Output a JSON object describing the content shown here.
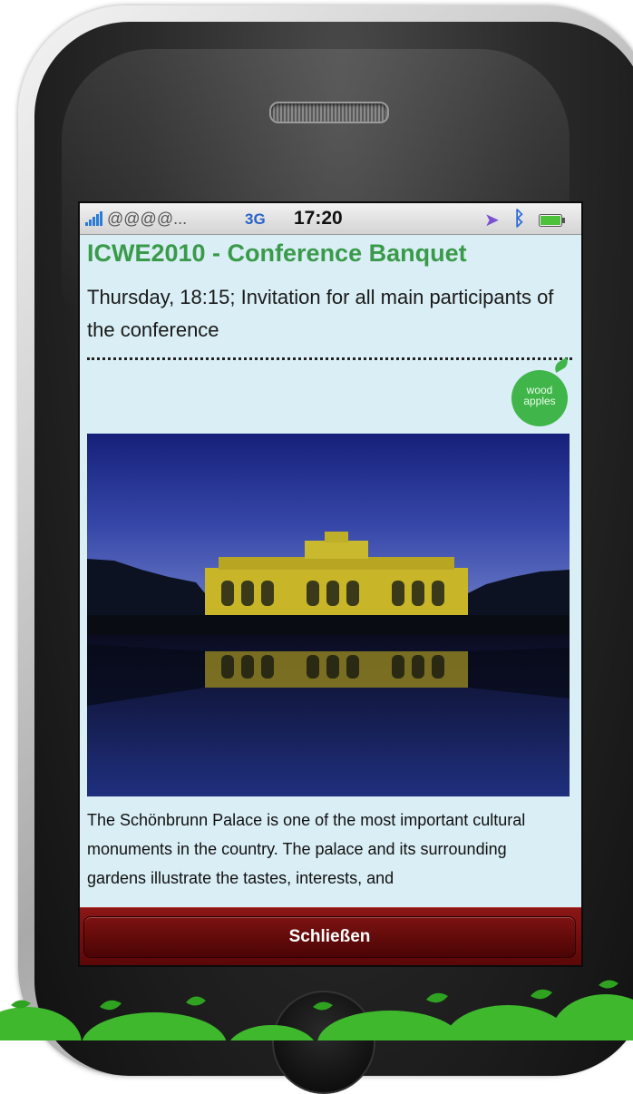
{
  "status_bar": {
    "carrier": "@@@@...",
    "network": "3G",
    "time": "17:20"
  },
  "event": {
    "title": "ICWE2010 - Conference Banquet",
    "subtitle": "Thursday, 18:15; Invitation for all main participants of the conference",
    "description": "The Schönbrunn Palace is one of the most important cultural monuments in the country. The palace and its surrounding gardens illustrate the tastes, interests, and"
  },
  "logo": {
    "line1": "wood",
    "line2": "apples"
  },
  "toolbar": {
    "close_label": "Schließen"
  },
  "icons": {
    "signal": "signal-bars-icon",
    "location": "location-arrow-icon",
    "bluetooth": "bluetooth-icon",
    "battery": "battery-icon"
  },
  "colors": {
    "title_green": "#3a9a4a",
    "screen_bg": "#d9eef5",
    "button_red": "#7d1212",
    "logo_green": "#3fb54a",
    "network_blue": "#2a62c8"
  }
}
